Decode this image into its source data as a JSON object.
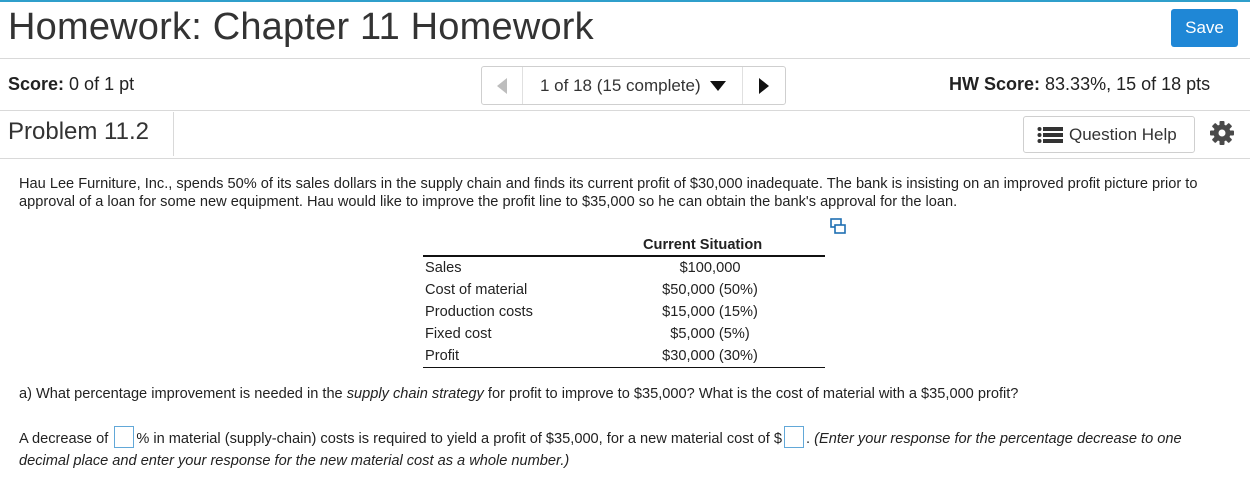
{
  "header": {
    "title": "Homework: Chapter 11 Homework",
    "save_label": "Save"
  },
  "score_bar": {
    "score_label": "Score:",
    "score_value": "0 of 1 pt",
    "nav_position": "1 of 18 (15 complete)",
    "hw_score_label": "HW Score:",
    "hw_score_value": "83.33%, 15 of 18 pts"
  },
  "problem": {
    "title": "Problem 11.2",
    "question_help_label": "Question Help",
    "text": "Hau Lee Furniture, Inc., spends 50% of its sales dollars in the supply chain and finds its current profit of $30,000 inadequate. The bank is insisting on an improved profit picture prior to approval of a loan for some new equipment. Hau would like to improve the profit line to $35,000 so he can obtain the bank's approval for the loan."
  },
  "table": {
    "header": "Current Situation",
    "rows": [
      {
        "label": "Sales",
        "value": "$100,000"
      },
      {
        "label": "Cost of material",
        "value": "$50,000 (50%)"
      },
      {
        "label": "Production costs",
        "value": "$15,000 (15%)"
      },
      {
        "label": "Fixed cost",
        "value": "$5,000 (5%)"
      },
      {
        "label": "Profit",
        "value": "$30,000 (30%)"
      }
    ]
  },
  "question_a": {
    "part1": "a) What percentage improvement is needed in the ",
    "term": "supply chain strategy",
    "part2": " for profit to improve to $35,000? What is the cost of material with a $35,000 profit?"
  },
  "answer": {
    "prefix": "A decrease of ",
    "middle": "% in material (supply-chain) costs is required to yield a profit of $35,000, for a new material cost of $",
    "suffix": ".",
    "hint": " (Enter your response for the percentage decrease to one decimal place and enter your response for the new material cost as a whole number.)",
    "percent_value": "",
    "cost_value": ""
  },
  "colors": {
    "accent": "#1f87d6",
    "top_rule": "#2f9fcb",
    "input_border": "#62a8d8"
  },
  "icons": [
    "chevron-left-icon",
    "caret-down-icon",
    "chevron-right-icon",
    "list-icon",
    "gear-icon",
    "expand-icon"
  ]
}
